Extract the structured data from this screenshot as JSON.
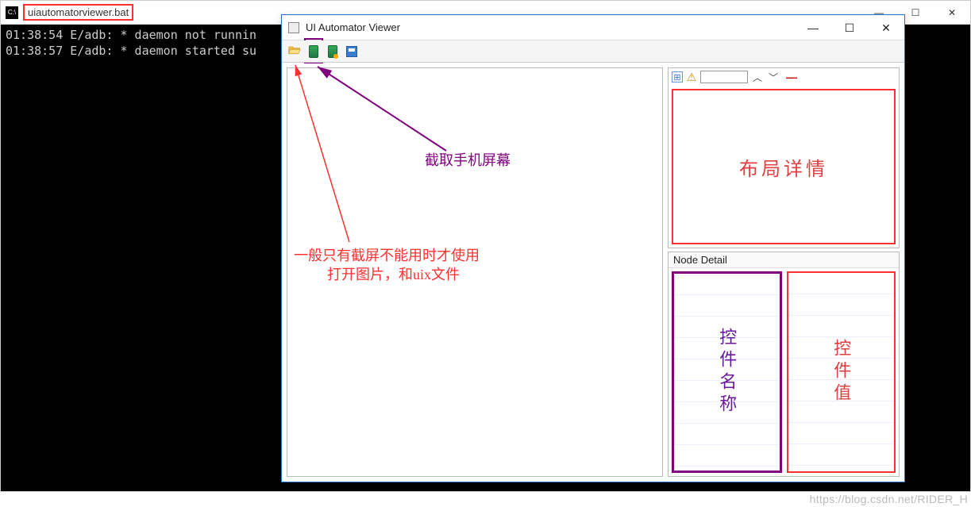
{
  "cmd": {
    "icon_text": "C:\\",
    "title": "uiautomatorviewer.bat",
    "buttons": {
      "min": "—",
      "max": "☐",
      "close": "✕"
    },
    "lines": [
      "01:38:54 E/adb: * daemon not runnin",
      "01:38:57 E/adb: * daemon started su"
    ]
  },
  "uav": {
    "title": "UI Automator Viewer",
    "buttons": {
      "min": "—",
      "max": "☐",
      "close": "✕"
    },
    "toolbar": {
      "open": "open-file",
      "screenshot": "device-screenshot",
      "screenshot_compressed": "device-screenshot-compressed",
      "save": "save"
    },
    "tree_toolbar": {
      "expand": "⊞",
      "warn": "⚠",
      "search_value": "",
      "up": "︿",
      "down": "﹀",
      "minus": "—"
    },
    "layout_label": "布局详情",
    "node_detail_title": "Node Detail",
    "col_name_label": "控件名称",
    "col_value_label": "控件值"
  },
  "annotations": {
    "purple_arrow_text": "截取手机屏幕",
    "red_line1": "一般只有截屏不能用时才使用",
    "red_line2": "打开图片，和uix文件"
  },
  "watermark": "https://blog.csdn.net/RIDER_H"
}
